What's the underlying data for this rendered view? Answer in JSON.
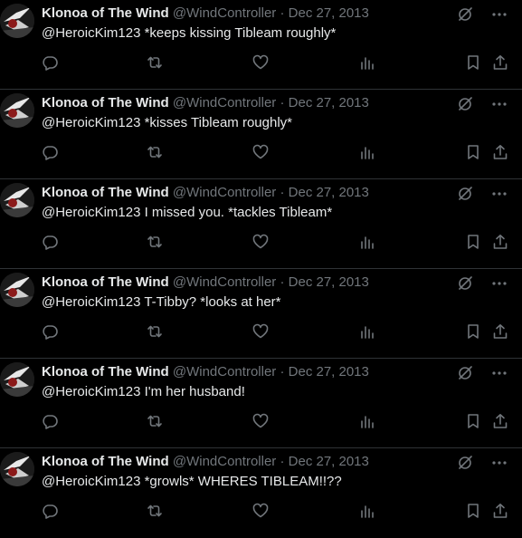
{
  "tweets": [
    {
      "name": "Klonoa of The Wind",
      "handle": "@WindController",
      "separator": "·",
      "date": "Dec 27, 2013",
      "text": "@HeroicKim123 *keeps kissing Tibleam roughly*"
    },
    {
      "name": "Klonoa of The Wind",
      "handle": "@WindController",
      "separator": "·",
      "date": "Dec 27, 2013",
      "text": "@HeroicKim123 *kisses Tibleam roughly*"
    },
    {
      "name": "Klonoa of The Wind",
      "handle": "@WindController",
      "separator": "·",
      "date": "Dec 27, 2013",
      "text": "@HeroicKim123 I missed you. *tackles Tibleam*"
    },
    {
      "name": "Klonoa of The Wind",
      "handle": "@WindController",
      "separator": "·",
      "date": "Dec 27, 2013",
      "text": "@HeroicKim123 T-Tibby? *looks at her*"
    },
    {
      "name": "Klonoa of The Wind",
      "handle": "@WindController",
      "separator": "·",
      "date": "Dec 27, 2013",
      "text": "@HeroicKim123 I'm her husband!"
    },
    {
      "name": "Klonoa of The Wind",
      "handle": "@WindController",
      "separator": "·",
      "date": "Dec 27, 2013",
      "text": "@HeroicKim123 *growls* WHERES TIBLEAM!!??"
    }
  ],
  "icons": {
    "grok": "grok-icon",
    "more": "more-icon",
    "reply": "reply-icon",
    "retweet": "retweet-icon",
    "like": "like-icon",
    "views": "views-icon",
    "bookmark": "bookmark-icon",
    "share": "share-icon"
  },
  "colors": {
    "background": "#000000",
    "text": "#e7e9ea",
    "muted": "#71767b",
    "divider": "#2f3336"
  }
}
